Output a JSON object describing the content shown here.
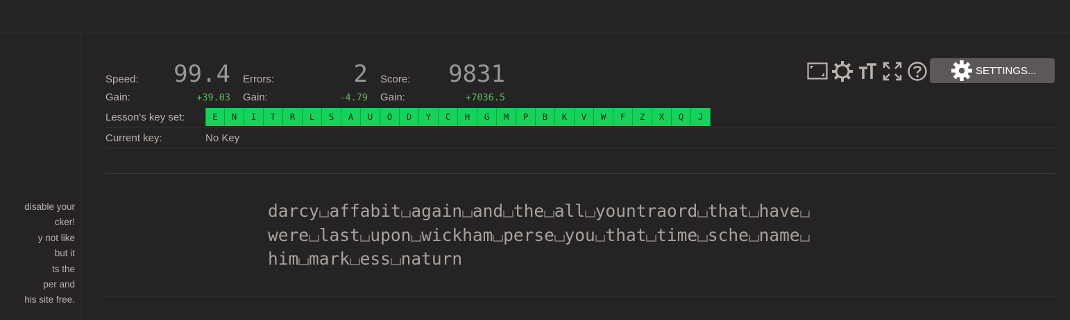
{
  "sidebar": {
    "ad_lines": [
      "disable your",
      "cker!",
      "y not like",
      "but it",
      "ts the",
      "per and",
      "his site free."
    ]
  },
  "stats": {
    "speed_label": "Speed:",
    "speed_value": "99.4",
    "speed_gain_label": "Gain:",
    "speed_gain_value": "+39.03",
    "errors_label": "Errors:",
    "errors_value": "2",
    "errors_gain_label": "Gain:",
    "errors_gain_value": "-4.79",
    "score_label": "Score:",
    "score_value": "9831",
    "score_gain_label": "Gain:",
    "score_gain_value": "+7036.5"
  },
  "keyset": {
    "label": "Lesson's key set:",
    "keys": [
      "E",
      "N",
      "I",
      "T",
      "R",
      "L",
      "S",
      "A",
      "U",
      "O",
      "D",
      "Y",
      "C",
      "H",
      "G",
      "M",
      "P",
      "B",
      "K",
      "V",
      "W",
      "F",
      "Z",
      "X",
      "Q",
      "J"
    ]
  },
  "current_key": {
    "label": "Current key:",
    "value": "No Key"
  },
  "toolbar": {
    "settings_label": "SETTINGS...",
    "icons": [
      "window-frame-icon",
      "brightness-icon",
      "font-size-icon",
      "fullscreen-icon",
      "help-icon"
    ]
  },
  "lesson": {
    "lines": [
      [
        "darcy",
        "affabit",
        "again",
        "and",
        "the",
        "all",
        "yountraord",
        "that",
        "have",
        ""
      ],
      [
        "were",
        "last",
        "upon",
        "wickham",
        "perse",
        "you",
        "that",
        "time",
        "sche",
        "name",
        ""
      ],
      [
        "him",
        "mark",
        "ess",
        "naturn"
      ]
    ]
  },
  "colors": {
    "background": "#252323",
    "key_green": "#14d25a",
    "gain_green": "#5cb85c",
    "button_bg": "#5c5858"
  }
}
